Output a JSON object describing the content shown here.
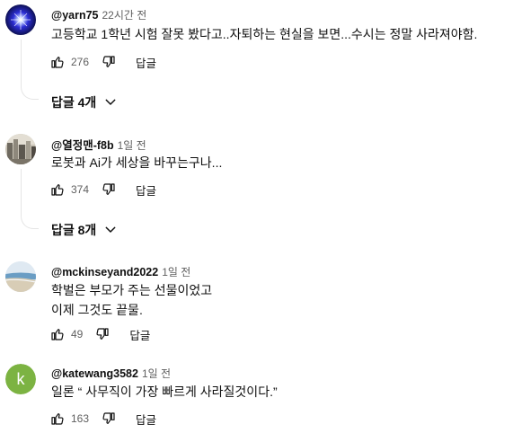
{
  "comments": [
    {
      "author": "@yarn75",
      "time": "22시간 전",
      "text": "고등학교 1학년 시험 잘못 봤다고..자퇴하는 현실을 보면...수시는 정말 사라져야함.",
      "likes": "276",
      "reply_label": "답글",
      "replies_label": "답글 4개",
      "avatar_icon": "starburst-avatar-icon"
    },
    {
      "author": "@열정맨-f8b",
      "time": "1일 전",
      "text": "로봇과 Ai가 세상을 바꾸는구나...",
      "likes": "374",
      "reply_label": "답글",
      "replies_label": "답글 8개",
      "avatar_icon": "cityscape-avatar-icon"
    },
    {
      "author": "@mckinseyand2022",
      "time": "1일 전",
      "text": "학벌은 부모가 주는 선물이었고\n이제 그것도 끝물.",
      "likes": "49",
      "reply_label": "답글",
      "avatar_icon": "beach-avatar-icon"
    },
    {
      "author": "@katewang3582",
      "time": "1일 전",
      "text": "일론 “ 사무직이 가장 빠르게 사라질것이다.”",
      "likes": "163",
      "reply_label": "답글",
      "avatar_letter": "k",
      "avatar_color": "#7cb342"
    }
  ]
}
